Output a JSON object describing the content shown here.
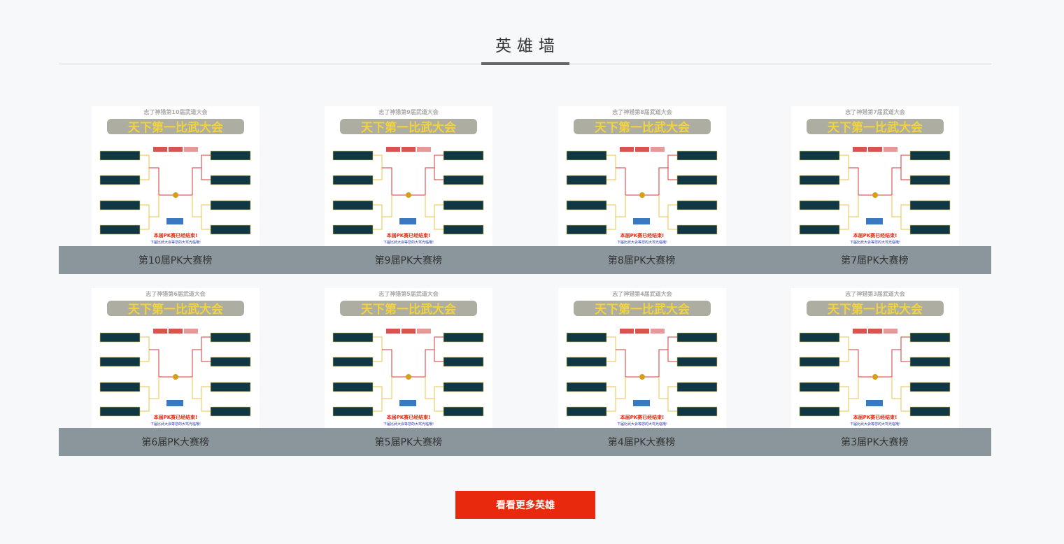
{
  "section": {
    "title": "英雄墙"
  },
  "cards": [
    {
      "label": "第10届PK大赛榜",
      "thumb_top": "志了神猎第10届武道大会"
    },
    {
      "label": "第9届PK大赛榜",
      "thumb_top": "志了神猎第9届武道大会"
    },
    {
      "label": "第8届PK大赛榜",
      "thumb_top": "志了神猎第8届武道大会"
    },
    {
      "label": "第7届PK大赛榜",
      "thumb_top": "志了神猎第7届武道大会"
    },
    {
      "label": "第6届PK大赛榜",
      "thumb_top": "志了神猎第6届武道大会"
    },
    {
      "label": "第5届PK大赛榜",
      "thumb_top": "志了神猎第5届武道大会"
    },
    {
      "label": "第4届PK大赛榜",
      "thumb_top": "志了神猎第4届武道大会"
    },
    {
      "label": "第3届PK大赛榜",
      "thumb_top": "志了神猎第3届武道大会"
    }
  ],
  "thumb_common": {
    "banner": "天下第一比武大会",
    "ended": "本届PK赛已经结束!",
    "next": "下届比武大会等您的大驾光临哦!"
  },
  "more_button": {
    "label": "看看更多英雄"
  },
  "colors": {
    "accent": "#e8290e",
    "caption_bg": "#8a969b",
    "box": "#0f3844",
    "bracket_red": "#d23a3a",
    "bracket_yellow": "#e8c54a"
  }
}
